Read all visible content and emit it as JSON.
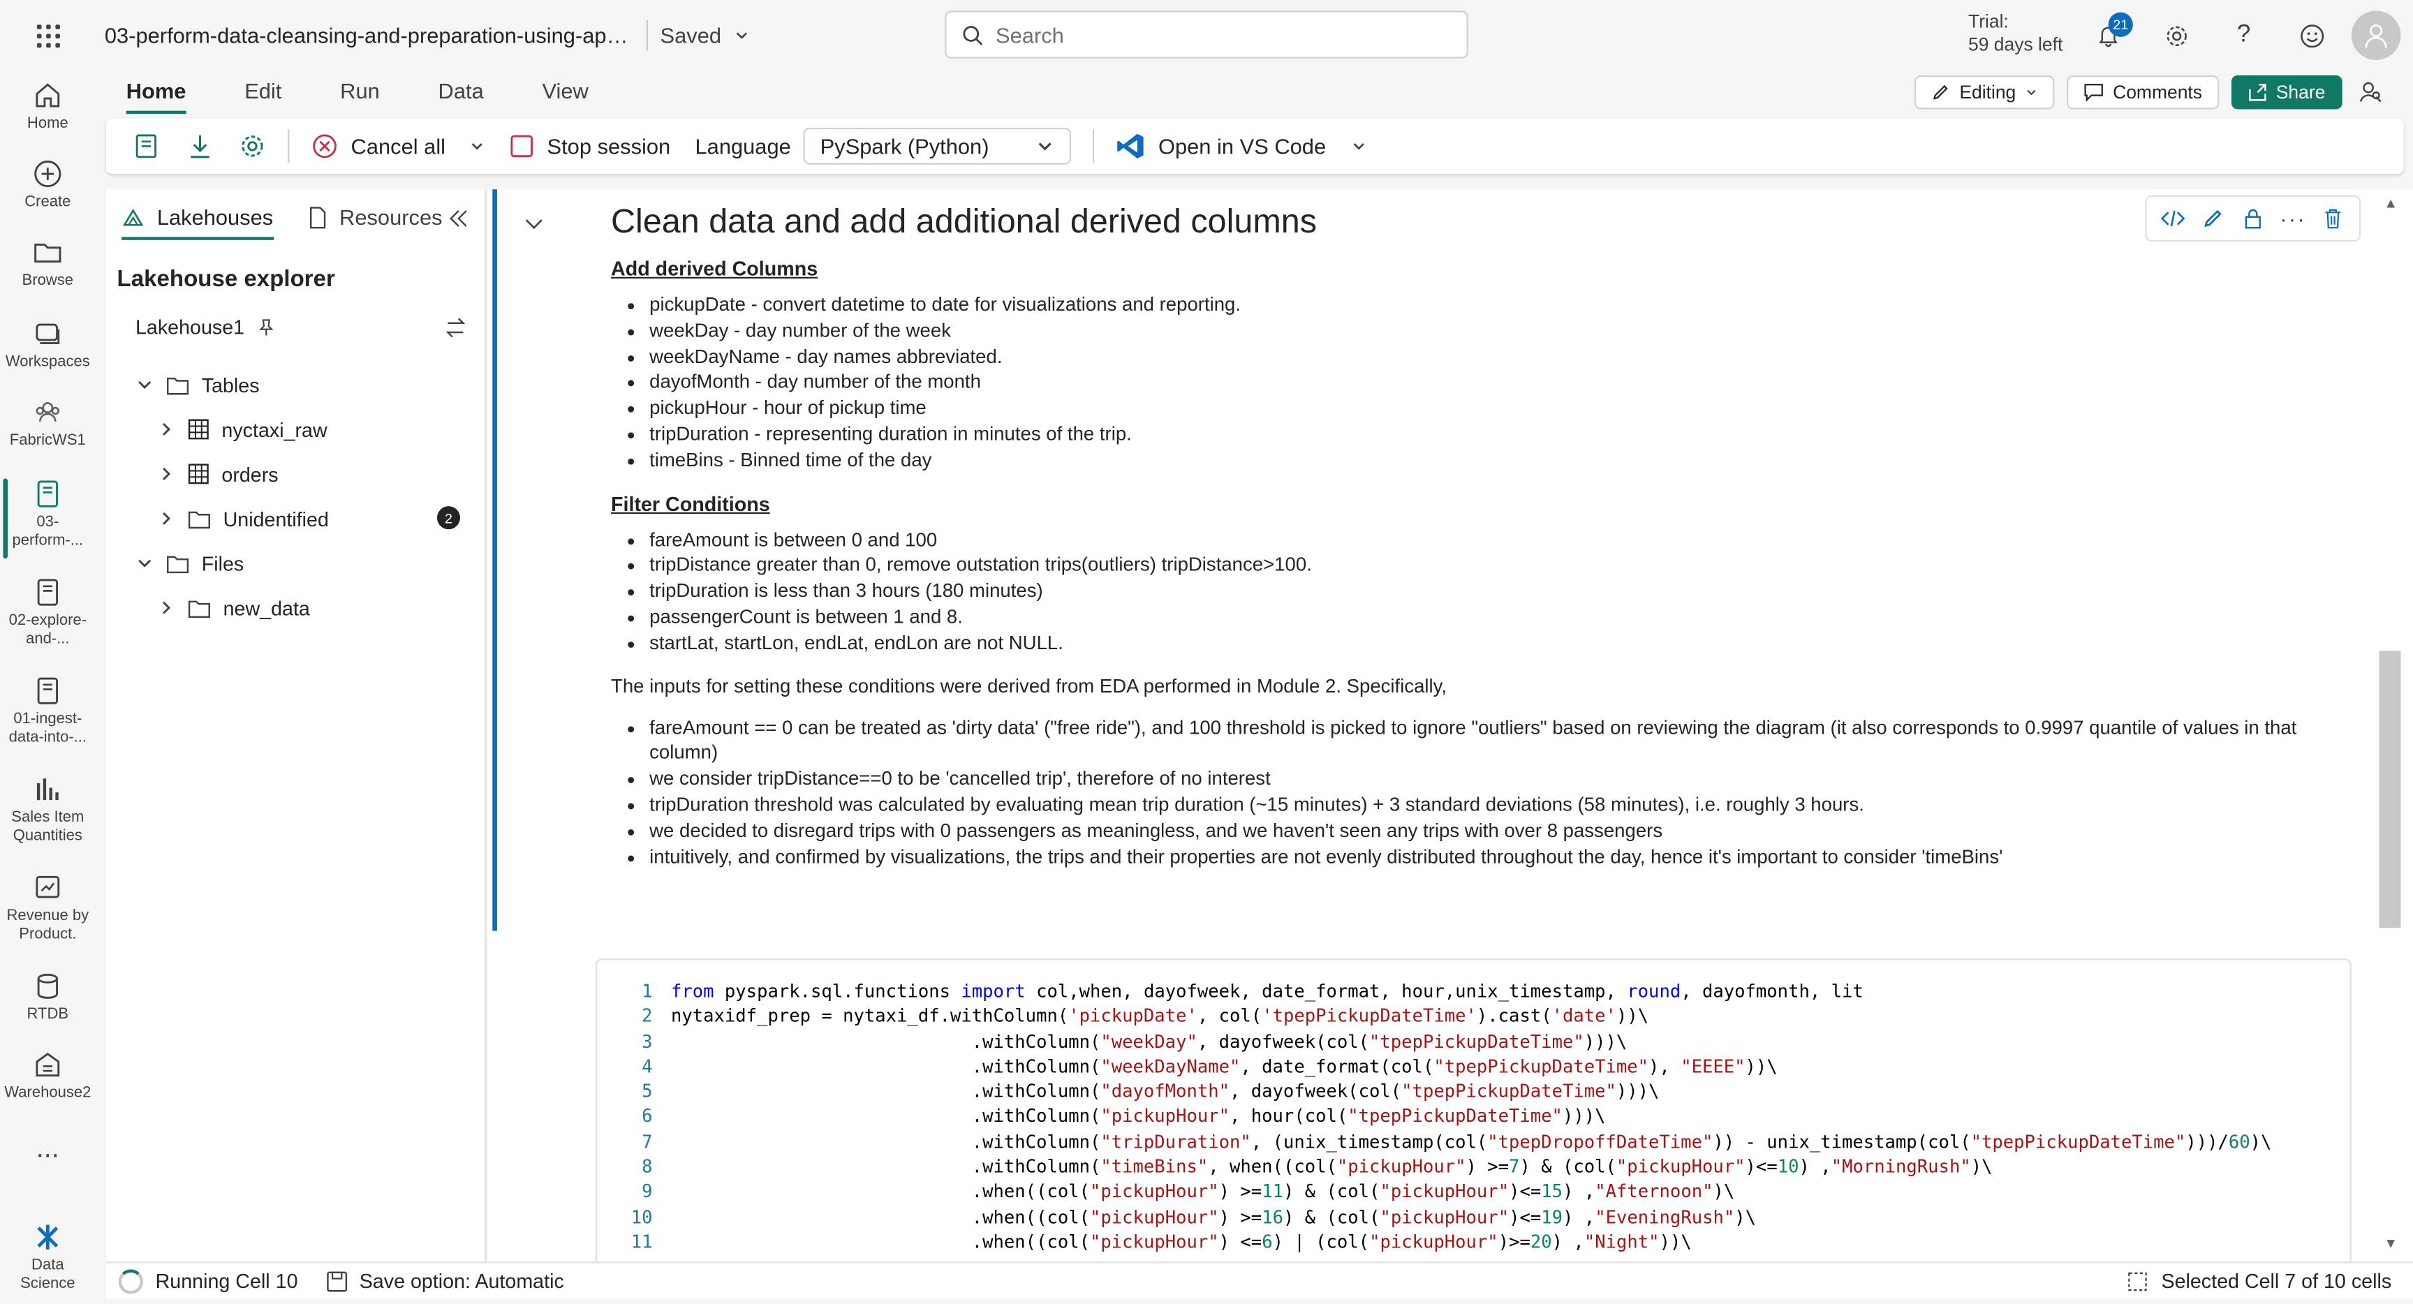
{
  "topbar": {
    "doc_title": "03-perform-data-cleansing-and-preparation-using-apache...",
    "saved_label": "Saved",
    "search_placeholder": "Search",
    "trial_line1": "Trial:",
    "trial_line2": "59 days left",
    "notification_count": "21"
  },
  "rail": {
    "items": [
      {
        "label": "Home"
      },
      {
        "label": "Create"
      },
      {
        "label": "Browse"
      },
      {
        "label": "Workspaces"
      },
      {
        "label": "FabricWS1"
      },
      {
        "label": "03-\nperform-..."
      },
      {
        "label": "02-explore-\nand-..."
      },
      {
        "label": "01-ingest-\ndata-into-..."
      },
      {
        "label": "Sales Item\nQuantities"
      },
      {
        "label": "Revenue by\nProduct."
      },
      {
        "label": "RTDB"
      },
      {
        "label": "Warehouse2"
      },
      {
        "label": "Data\nScience"
      }
    ],
    "more": "..."
  },
  "ribbon": {
    "tabs": [
      "Home",
      "Edit",
      "Run",
      "Data",
      "View"
    ],
    "editing_label": "Editing",
    "comments_label": "Comments",
    "share_label": "Share",
    "cancel_all": "Cancel all",
    "stop_session": "Stop session",
    "language_label": "Language",
    "language_value": "PySpark (Python)",
    "open_vscode": "Open in VS Code"
  },
  "explorer": {
    "tab_lakehouses": "Lakehouses",
    "tab_resources": "Resources",
    "title": "Lakehouse explorer",
    "lakehouse_name": "Lakehouse1",
    "tables_label": "Tables",
    "tables": [
      "nyctaxi_raw",
      "orders",
      "Unidentified"
    ],
    "unidentified_count": "2",
    "files_label": "Files",
    "files": [
      "new_data"
    ]
  },
  "markdown": {
    "heading": "Clean data and add additional derived columns",
    "derived_heading": "Add derived Columns",
    "derived": [
      "pickupDate - convert datetime to date for visualizations and reporting.",
      "weekDay - day number of the week",
      "weekDayName - day names abbreviated.",
      "dayofMonth - day number of the month",
      "pickupHour - hour of pickup time",
      "tripDuration - representing duration in minutes of the trip.",
      "timeBins - Binned time of the day"
    ],
    "filter_heading": "Filter Conditions",
    "filters": [
      "fareAmount is between 0 and 100",
      "tripDistance greater than 0, remove outstation trips(outliers) tripDistance>100.",
      "tripDuration is less than 3 hours (180 minutes)",
      "passengerCount is between 1 and 8.",
      "startLat, startLon, endLat, endLon are not NULL."
    ],
    "inputs_text": "The inputs for setting these conditions were derived from EDA performed in Module 2. Specifically,",
    "notes": [
      "fareAmount == 0 can be treated as 'dirty data' (\"free ride\"), and 100 threshold is picked to ignore \"outliers\" based on reviewing the diagram (it also corresponds to 0.9997 quantile of values in that column)",
      "we consider tripDistance==0 to be 'cancelled trip', therefore of no interest",
      "tripDuration threshold was calculated by evaluating mean trip duration (~15 minutes) + 3 standard deviations (58 minutes), i.e. roughly 3 hours.",
      "we decided to disregard trips with 0 passengers as meaningless, and we haven't seen any trips with over 8 passengers",
      "intuitively, and confirmed by visualizations, the trips and their properties are not evenly distributed throughout the day, hence it's important to consider 'timeBins'"
    ]
  },
  "code": {
    "lines": [
      "from pyspark.sql.functions import col,when, dayofweek, date_format, hour,unix_timestamp, round, dayofmonth, lit",
      "nytaxidf_prep = nytaxi_df.withColumn('pickupDate', col('tpepPickupDateTime').cast('date'))\\",
      "                            .withColumn(\"weekDay\", dayofweek(col(\"tpepPickupDateTime\")))\\",
      "                            .withColumn(\"weekDayName\", date_format(col(\"tpepPickupDateTime\"), \"EEEE\"))\\",
      "                            .withColumn(\"dayofMonth\", dayofweek(col(\"tpepPickupDateTime\")))\\",
      "                            .withColumn(\"pickupHour\", hour(col(\"tpepPickupDateTime\")))\\",
      "                            .withColumn(\"tripDuration\", (unix_timestamp(col(\"tpepDropoffDateTime\")) - unix_timestamp(col(\"tpepPickupDateTime\")))/60)\\",
      "                            .withColumn(\"timeBins\", when((col(\"pickupHour\") >=7) & (col(\"pickupHour\")<=10) ,\"MorningRush\")\\",
      "                            .when((col(\"pickupHour\") >=11) & (col(\"pickupHour\")<=15) ,\"Afternoon\")\\",
      "                            .when((col(\"pickupHour\") >=16) & (col(\"pickupHour\")<=19) ,\"EveningRush\")\\",
      "                            .when((col(\"pickupHour\") <=6) | (col(\"pickupHour\")>=20) ,\"Night\"))\\"
    ]
  },
  "status": {
    "running": "Running Cell 10",
    "save_option": "Save option: Automatic",
    "selected": "Selected Cell 7 of 10 cells"
  }
}
